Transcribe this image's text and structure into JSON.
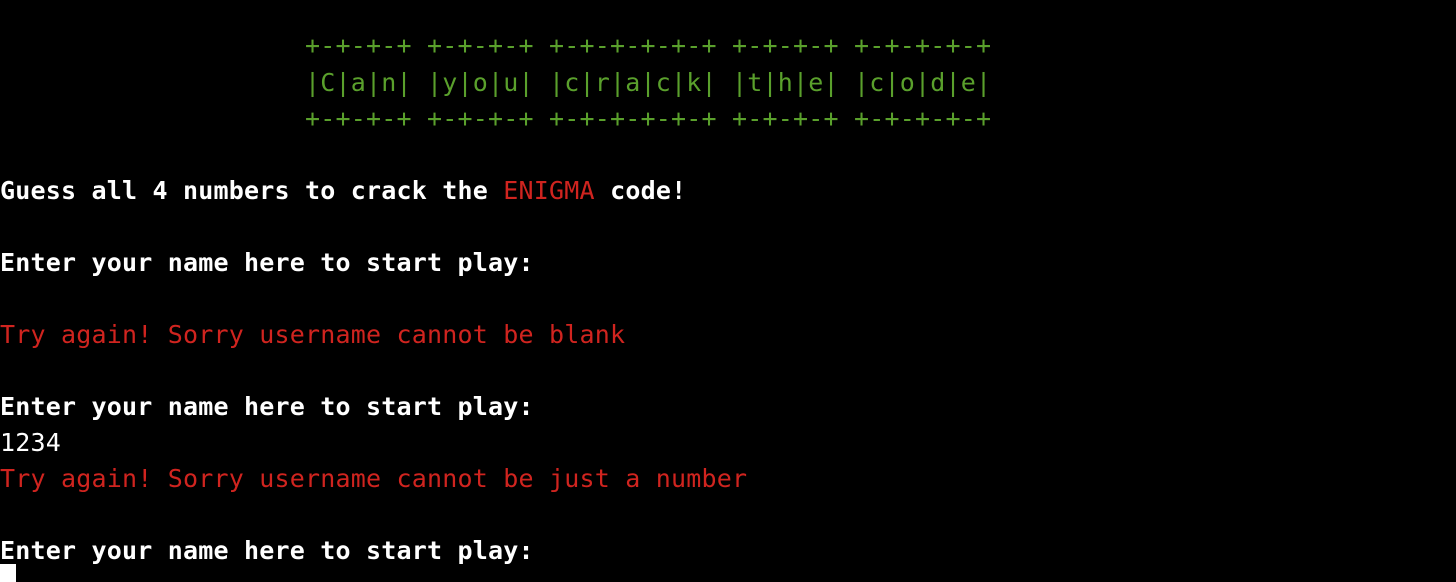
{
  "banner": {
    "top_border": "+-+-+-+ +-+-+-+ +-+-+-+-+-+ +-+-+-+ +-+-+-+-+",
    "title_row": "|C|a|n| |y|o|u| |c|r|a|c|k| |t|h|e| |c|o|d|e|",
    "bottom_border": "+-+-+-+ +-+-+-+ +-+-+-+-+-+ +-+-+-+ +-+-+-+-+"
  },
  "intro": {
    "prefix": "Guess all 4 numbers to crack the ",
    "highlight": "ENIGMA",
    "suffix": " code!"
  },
  "console": [
    {
      "type": "prompt",
      "text": "Enter your name here to start play:"
    },
    {
      "type": "error",
      "text": "Try again! Sorry username cannot be blank"
    },
    {
      "type": "prompt",
      "text": "Enter your name here to start play:"
    },
    {
      "type": "input",
      "text": "1234"
    },
    {
      "type": "error",
      "text": "Try again! Sorry username cannot be just a number"
    },
    {
      "type": "prompt",
      "text": "Enter your name here to start play:"
    }
  ],
  "colors": {
    "background": "#000000",
    "banner": "#5aa02c",
    "error": "#d0241f",
    "text": "#ffffff"
  }
}
